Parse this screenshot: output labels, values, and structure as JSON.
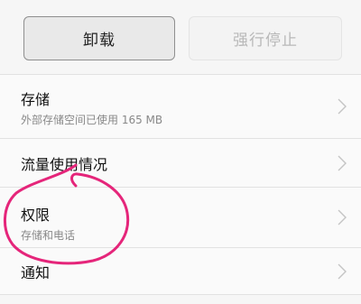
{
  "actions": {
    "uninstall_label": "卸载",
    "force_stop_label": "强行停止"
  },
  "settings": {
    "items": [
      {
        "title": "存储",
        "subtitle": "外部存储空间已使用 165 MB"
      },
      {
        "title": "流量使用情况"
      },
      {
        "title": "权限",
        "subtitle": "存储和电话"
      },
      {
        "title": "通知"
      }
    ]
  },
  "colors": {
    "annotation_circle": "#e5257a"
  }
}
